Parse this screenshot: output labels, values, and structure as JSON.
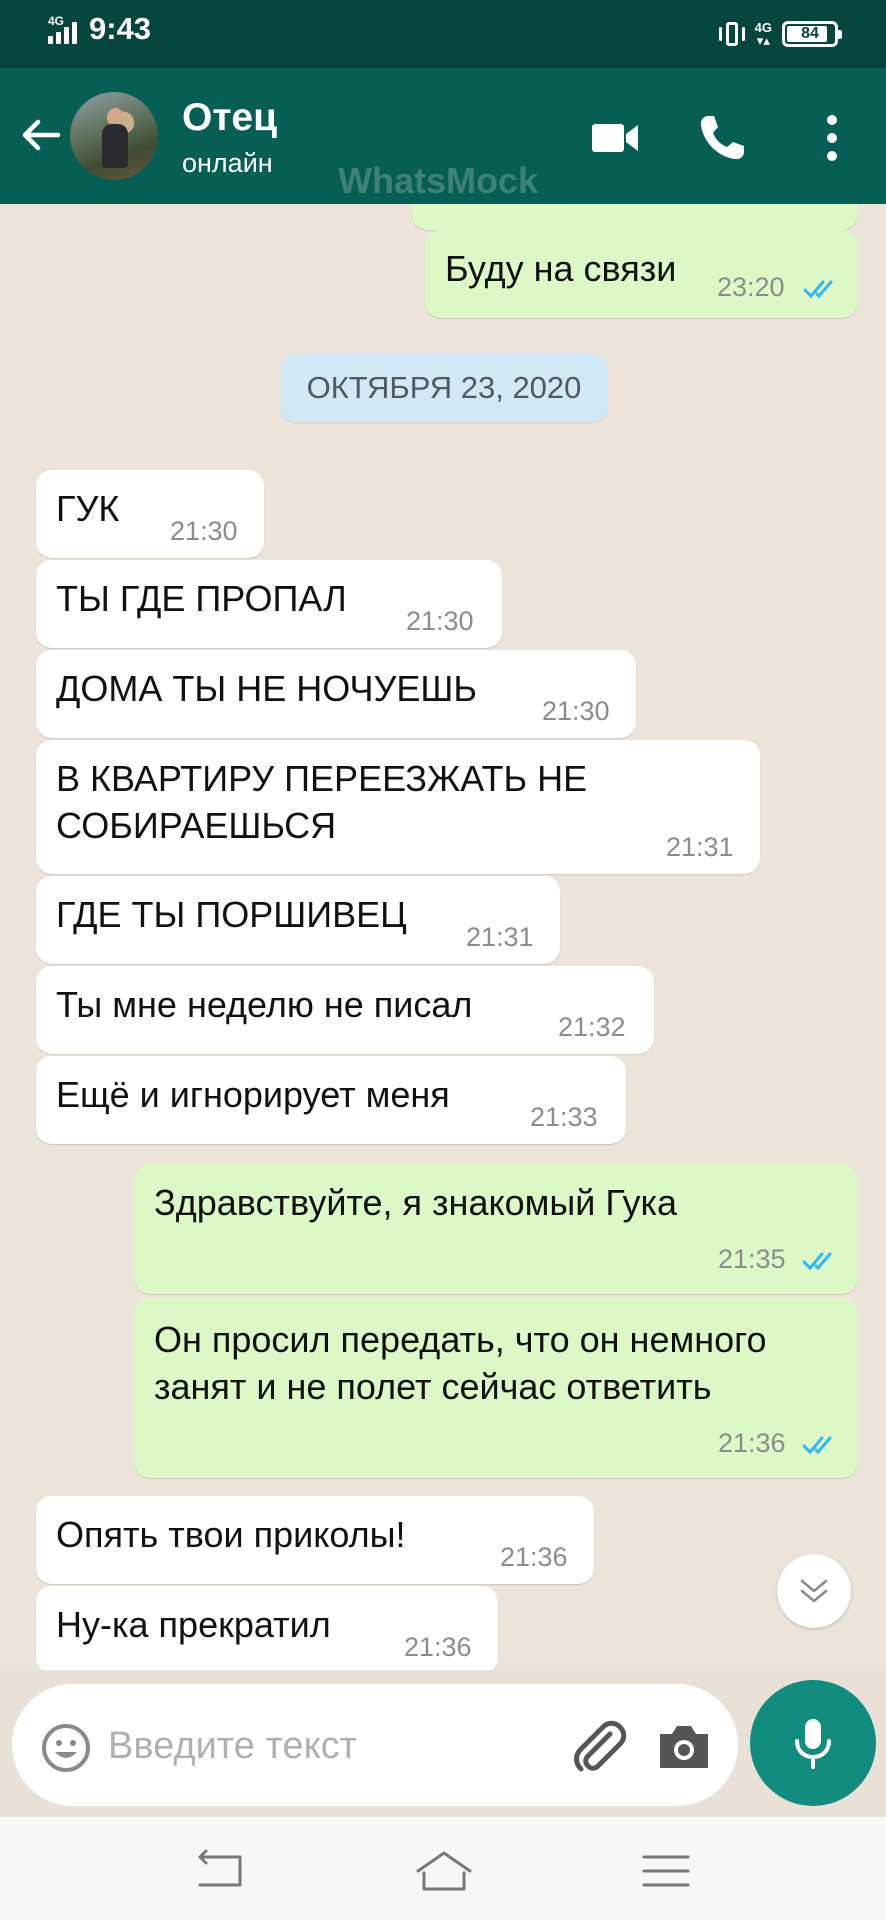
{
  "status_bar": {
    "network": "4G",
    "time": "9:43",
    "network_right": "4G",
    "battery": "84"
  },
  "header": {
    "contact_name": "Отец",
    "contact_status": "онлайн",
    "watermark": "WhatsMock"
  },
  "chat": {
    "top_message": {
      "text": "Буду на связи",
      "time": "23:20"
    },
    "date_chip": "ОКТЯБРЯ 23, 2020",
    "messages": [
      {
        "dir": "in",
        "text": "ГУК",
        "time": "21:30"
      },
      {
        "dir": "in",
        "text": "ТЫ ГДЕ ПРОПАЛ",
        "time": "21:30"
      },
      {
        "dir": "in",
        "text": "ДОМА ТЫ НЕ НОЧУЕШЬ",
        "time": "21:30"
      },
      {
        "dir": "in",
        "text": "В КВАРТИРУ ПЕРЕЕЗЖАТЬ НЕ СОБИРАЕШЬСЯ",
        "time": "21:31"
      },
      {
        "dir": "in",
        "text": "ГДЕ ТЫ ПОРШИВЕЦ",
        "time": "21:31"
      },
      {
        "dir": "in",
        "text": "Ты мне неделю не писал",
        "time": "21:32"
      },
      {
        "dir": "in",
        "text": "Ещё и игнорирует меня",
        "time": "21:33"
      },
      {
        "dir": "out",
        "text": "Здравствуйте, я знакомый Гука",
        "time": "21:35"
      },
      {
        "dir": "out",
        "text": "Он просил передать, что он немного занят и не полет сейчас ответить",
        "time": "21:36"
      },
      {
        "dir": "in",
        "text": "Опять твои приколы!",
        "time": "21:36"
      },
      {
        "dir": "in",
        "text": "Ну-ка прекратил",
        "time": "21:36"
      }
    ]
  },
  "composer": {
    "placeholder": "Введите текст",
    "value": ""
  },
  "colors": {
    "status_bar": "#06463f",
    "header": "#075e54",
    "outgoing_bubble": "#dcf8c6",
    "incoming_bubble": "#ffffff",
    "chat_background": "#ece4da",
    "date_chip": "#d1e8f7",
    "mic_button": "#128c7e",
    "read_ticks": "#34b7f1"
  },
  "icons": [
    "back-arrow-icon",
    "video-call-icon",
    "phone-call-icon",
    "more-vert-icon",
    "double-check-icon",
    "chevron-down-icon",
    "emoji-icon",
    "attach-icon",
    "camera-icon",
    "mic-icon",
    "nav-back-icon",
    "nav-home-icon",
    "nav-menu-icon"
  ]
}
